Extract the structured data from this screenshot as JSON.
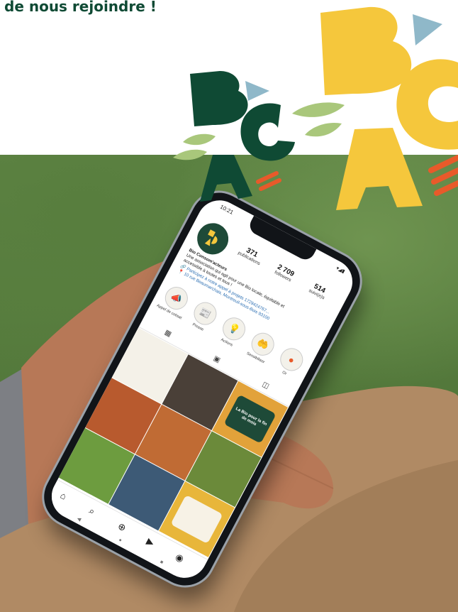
{
  "headline": {
    "text": "de nous rejoindre !"
  },
  "colors": {
    "dark_green": "#0f4a34",
    "yellow": "#f5c73c",
    "light_blue": "#8fb8c9",
    "leaf_green": "#a9c77b",
    "orange": "#e85a2a",
    "photo_green": "#5a7f40"
  },
  "phone": {
    "status": {
      "time": "10:21",
      "icons": "▾◢▮"
    },
    "profile": {
      "avatar_icon": "bca-logo-icon",
      "stats": [
        {
          "value": "371",
          "label": "publications"
        },
        {
          "value": "2 709",
          "label": "followers"
        },
        {
          "value": "514",
          "label": "suivi(e)s"
        }
      ],
      "name": "Bio Consom'acteurs",
      "bio_line_1": "Une association qui agit pour une Bio locale, équitable et",
      "bio_line_2": "accessible à toutes et tous !",
      "link_1": "🔗 Participez à notre appel à projets 1729424767...",
      "link_2": "📍 10 rue Beaumarchais, Montreuil-sous-Bois 93100"
    },
    "highlights": [
      {
        "label": "Appel de cotisat",
        "icon": "megaphone-icon",
        "glyph": "📣"
      },
      {
        "label": "Presse",
        "icon": "newspaper-icon",
        "glyph": "📰"
      },
      {
        "label": "Actions",
        "icon": "lightbulb-icon",
        "glyph": "💡"
      },
      {
        "label": "Sensibiliser",
        "icon": "hands-icon",
        "glyph": "🤲"
      },
      {
        "label": "Or",
        "icon": "circle-icon",
        "glyph": "●"
      }
    ],
    "tabs": [
      {
        "icon": "grid-icon",
        "glyph": "▦"
      },
      {
        "icon": "reels-icon",
        "glyph": "▣"
      },
      {
        "icon": "tagged-icon",
        "glyph": "◫"
      }
    ],
    "grid_tiles": [
      {
        "type": "photo",
        "color": "#f4f1e8"
      },
      {
        "type": "photo",
        "color": "#4a4038"
      },
      {
        "type": "text",
        "color": "#e2a23a",
        "text": "La Bio pour la fin de mois"
      },
      {
        "type": "photo",
        "color": "#b85a2e"
      },
      {
        "type": "photo",
        "color": "#c06b34"
      },
      {
        "type": "photo",
        "color": "#6b8a3a"
      },
      {
        "type": "photo",
        "color": "#6d9c3f"
      },
      {
        "type": "photo",
        "color": "#3d5a76"
      },
      {
        "type": "text",
        "color": "#e8b63a",
        "text": ""
      },
      {
        "type": "photo",
        "color": "#d26a3a"
      },
      {
        "type": "text",
        "color": "#8db5c4",
        "text": ""
      },
      {
        "type": "photo",
        "color": "#9bb7a0"
      }
    ],
    "nav": [
      {
        "icon": "home-icon",
        "glyph": "⌂"
      },
      {
        "icon": "search-icon",
        "glyph": "⌕"
      },
      {
        "icon": "add-post-icon",
        "glyph": "⊕"
      },
      {
        "icon": "reels-icon",
        "glyph": "▶"
      },
      {
        "icon": "profile-icon",
        "glyph": "◉"
      }
    ],
    "system_nav": [
      {
        "icon": "back-icon",
        "glyph": "◀"
      },
      {
        "icon": "home-circle-icon",
        "glyph": "●"
      },
      {
        "icon": "recents-icon",
        "glyph": "■"
      }
    ]
  }
}
